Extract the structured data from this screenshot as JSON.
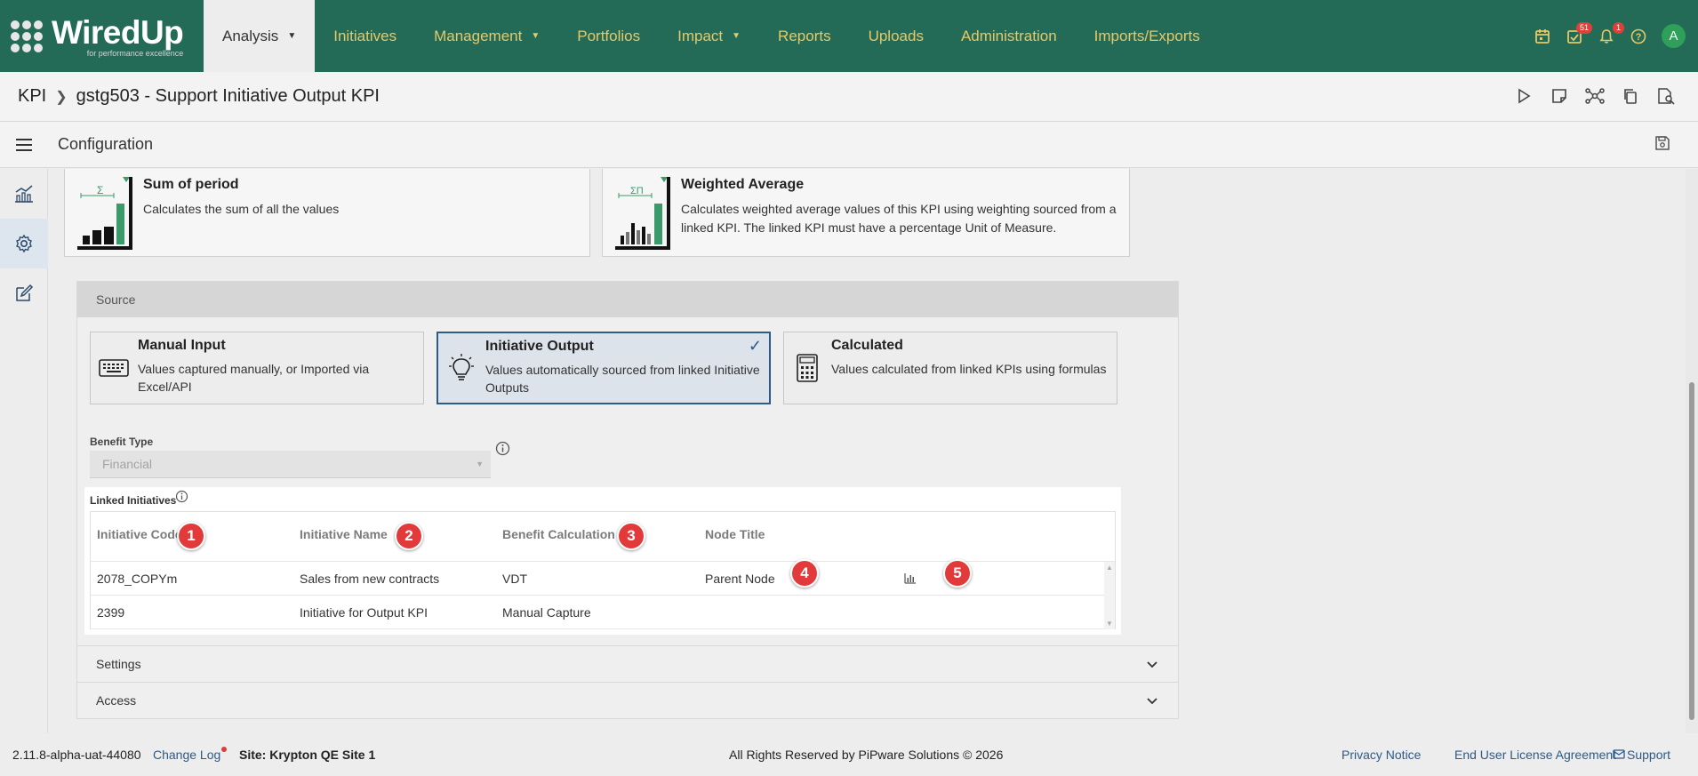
{
  "app": {
    "logo_text": "WiredUp",
    "logo_sub": "for performance excellence"
  },
  "nav": {
    "items": [
      {
        "label": "Analysis",
        "has_caret": true,
        "active": true
      },
      {
        "label": "Initiatives"
      },
      {
        "label": "Management",
        "has_caret": true
      },
      {
        "label": "Portfolios"
      },
      {
        "label": "Impact",
        "has_caret": true
      },
      {
        "label": "Reports"
      },
      {
        "label": "Uploads"
      },
      {
        "label": "Administration"
      },
      {
        "label": "Imports/Exports"
      }
    ],
    "icons": {
      "calendar": "calendar-icon",
      "tasks": "task-check-icon",
      "tasks_badge": "51",
      "notifications": "bell-icon",
      "notifications_badge": "1",
      "help": "help-icon",
      "avatar_initial": "A"
    },
    "accent_color": "#e7c867",
    "bg_color": "#236b56"
  },
  "breadcrumb": {
    "root": "KPI",
    "current": "gstg503 - Support Initiative Output KPI"
  },
  "config": {
    "title": "Configuration"
  },
  "aggregation": {
    "cards": [
      {
        "title": "Sum of period",
        "description": "Calculates the sum of all the values",
        "icon": "sum-chart-icon",
        "symbol": "Σ"
      },
      {
        "title": "Weighted Average",
        "description": "Calculates weighted average values of this KPI using weighting sourced from a linked KPI. The linked KPI must have a percentage Unit of Measure.",
        "icon": "weighted-chart-icon",
        "symbol": "ΣΠ"
      }
    ]
  },
  "source": {
    "header": "Source",
    "options": [
      {
        "title": "Manual Input",
        "description": "Values captured manually, or Imported via Excel/API",
        "icon": "keyboard-icon",
        "selected": false
      },
      {
        "title": "Initiative Output",
        "description": "Values automatically sourced from linked Initiative Outputs",
        "icon": "lightbulb-icon",
        "selected": true
      },
      {
        "title": "Calculated",
        "description": "Values calculated from linked KPIs using formulas",
        "icon": "calculator-icon",
        "selected": false
      }
    ],
    "benefit_type": {
      "label": "Benefit Type",
      "value": "Financial"
    },
    "linked": {
      "label": "Linked Initiatives",
      "columns": [
        "Initiative Code",
        "Initiative Name",
        "Benefit Calculation",
        "Node Title"
      ],
      "rows": [
        {
          "code": "2078_COPYm",
          "name": "Sales from new contracts",
          "calc": "VDT",
          "node": "Parent Node",
          "has_chart_icon": true
        },
        {
          "code": "2399",
          "name": "Initiative for Output KPI",
          "calc": "Manual Capture",
          "node": "",
          "has_chart_icon": false
        }
      ]
    },
    "markers": [
      "1",
      "2",
      "3",
      "4",
      "5"
    ]
  },
  "accordions": [
    {
      "label": "Settings"
    },
    {
      "label": "Access"
    }
  ],
  "footer": {
    "version": "2.11.8-alpha-uat-44080",
    "changelog": "Change Log",
    "site": "Site: Krypton QE Site 1",
    "copyright": "All Rights Reserved by PiPware Solutions © 2026",
    "privacy": "Privacy Notice",
    "eula": "End User License Agreement",
    "support": "Support"
  }
}
